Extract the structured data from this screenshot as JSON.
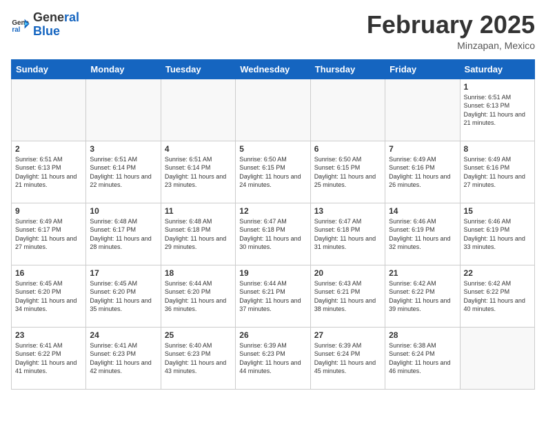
{
  "header": {
    "logo_line1": "General",
    "logo_line2": "Blue",
    "main_title": "February 2025",
    "subtitle": "Minzapan, Mexico"
  },
  "calendar": {
    "days_of_week": [
      "Sunday",
      "Monday",
      "Tuesday",
      "Wednesday",
      "Thursday",
      "Friday",
      "Saturday"
    ],
    "weeks": [
      [
        {
          "day": "",
          "info": ""
        },
        {
          "day": "",
          "info": ""
        },
        {
          "day": "",
          "info": ""
        },
        {
          "day": "",
          "info": ""
        },
        {
          "day": "",
          "info": ""
        },
        {
          "day": "",
          "info": ""
        },
        {
          "day": "1",
          "info": "Sunrise: 6:51 AM\nSunset: 6:13 PM\nDaylight: 11 hours and 21 minutes."
        }
      ],
      [
        {
          "day": "2",
          "info": "Sunrise: 6:51 AM\nSunset: 6:13 PM\nDaylight: 11 hours and 21 minutes."
        },
        {
          "day": "3",
          "info": "Sunrise: 6:51 AM\nSunset: 6:14 PM\nDaylight: 11 hours and 22 minutes."
        },
        {
          "day": "4",
          "info": "Sunrise: 6:51 AM\nSunset: 6:14 PM\nDaylight: 11 hours and 23 minutes."
        },
        {
          "day": "5",
          "info": "Sunrise: 6:50 AM\nSunset: 6:15 PM\nDaylight: 11 hours and 24 minutes."
        },
        {
          "day": "6",
          "info": "Sunrise: 6:50 AM\nSunset: 6:15 PM\nDaylight: 11 hours and 25 minutes."
        },
        {
          "day": "7",
          "info": "Sunrise: 6:49 AM\nSunset: 6:16 PM\nDaylight: 11 hours and 26 minutes."
        },
        {
          "day": "8",
          "info": "Sunrise: 6:49 AM\nSunset: 6:16 PM\nDaylight: 11 hours and 27 minutes."
        }
      ],
      [
        {
          "day": "9",
          "info": "Sunrise: 6:49 AM\nSunset: 6:17 PM\nDaylight: 11 hours and 27 minutes."
        },
        {
          "day": "10",
          "info": "Sunrise: 6:48 AM\nSunset: 6:17 PM\nDaylight: 11 hours and 28 minutes."
        },
        {
          "day": "11",
          "info": "Sunrise: 6:48 AM\nSunset: 6:18 PM\nDaylight: 11 hours and 29 minutes."
        },
        {
          "day": "12",
          "info": "Sunrise: 6:47 AM\nSunset: 6:18 PM\nDaylight: 11 hours and 30 minutes."
        },
        {
          "day": "13",
          "info": "Sunrise: 6:47 AM\nSunset: 6:18 PM\nDaylight: 11 hours and 31 minutes."
        },
        {
          "day": "14",
          "info": "Sunrise: 6:46 AM\nSunset: 6:19 PM\nDaylight: 11 hours and 32 minutes."
        },
        {
          "day": "15",
          "info": "Sunrise: 6:46 AM\nSunset: 6:19 PM\nDaylight: 11 hours and 33 minutes."
        }
      ],
      [
        {
          "day": "16",
          "info": "Sunrise: 6:45 AM\nSunset: 6:20 PM\nDaylight: 11 hours and 34 minutes."
        },
        {
          "day": "17",
          "info": "Sunrise: 6:45 AM\nSunset: 6:20 PM\nDaylight: 11 hours and 35 minutes."
        },
        {
          "day": "18",
          "info": "Sunrise: 6:44 AM\nSunset: 6:20 PM\nDaylight: 11 hours and 36 minutes."
        },
        {
          "day": "19",
          "info": "Sunrise: 6:44 AM\nSunset: 6:21 PM\nDaylight: 11 hours and 37 minutes."
        },
        {
          "day": "20",
          "info": "Sunrise: 6:43 AM\nSunset: 6:21 PM\nDaylight: 11 hours and 38 minutes."
        },
        {
          "day": "21",
          "info": "Sunrise: 6:42 AM\nSunset: 6:22 PM\nDaylight: 11 hours and 39 minutes."
        },
        {
          "day": "22",
          "info": "Sunrise: 6:42 AM\nSunset: 6:22 PM\nDaylight: 11 hours and 40 minutes."
        }
      ],
      [
        {
          "day": "23",
          "info": "Sunrise: 6:41 AM\nSunset: 6:22 PM\nDaylight: 11 hours and 41 minutes."
        },
        {
          "day": "24",
          "info": "Sunrise: 6:41 AM\nSunset: 6:23 PM\nDaylight: 11 hours and 42 minutes."
        },
        {
          "day": "25",
          "info": "Sunrise: 6:40 AM\nSunset: 6:23 PM\nDaylight: 11 hours and 43 minutes."
        },
        {
          "day": "26",
          "info": "Sunrise: 6:39 AM\nSunset: 6:23 PM\nDaylight: 11 hours and 44 minutes."
        },
        {
          "day": "27",
          "info": "Sunrise: 6:39 AM\nSunset: 6:24 PM\nDaylight: 11 hours and 45 minutes."
        },
        {
          "day": "28",
          "info": "Sunrise: 6:38 AM\nSunset: 6:24 PM\nDaylight: 11 hours and 46 minutes."
        },
        {
          "day": "",
          "info": ""
        }
      ]
    ]
  }
}
